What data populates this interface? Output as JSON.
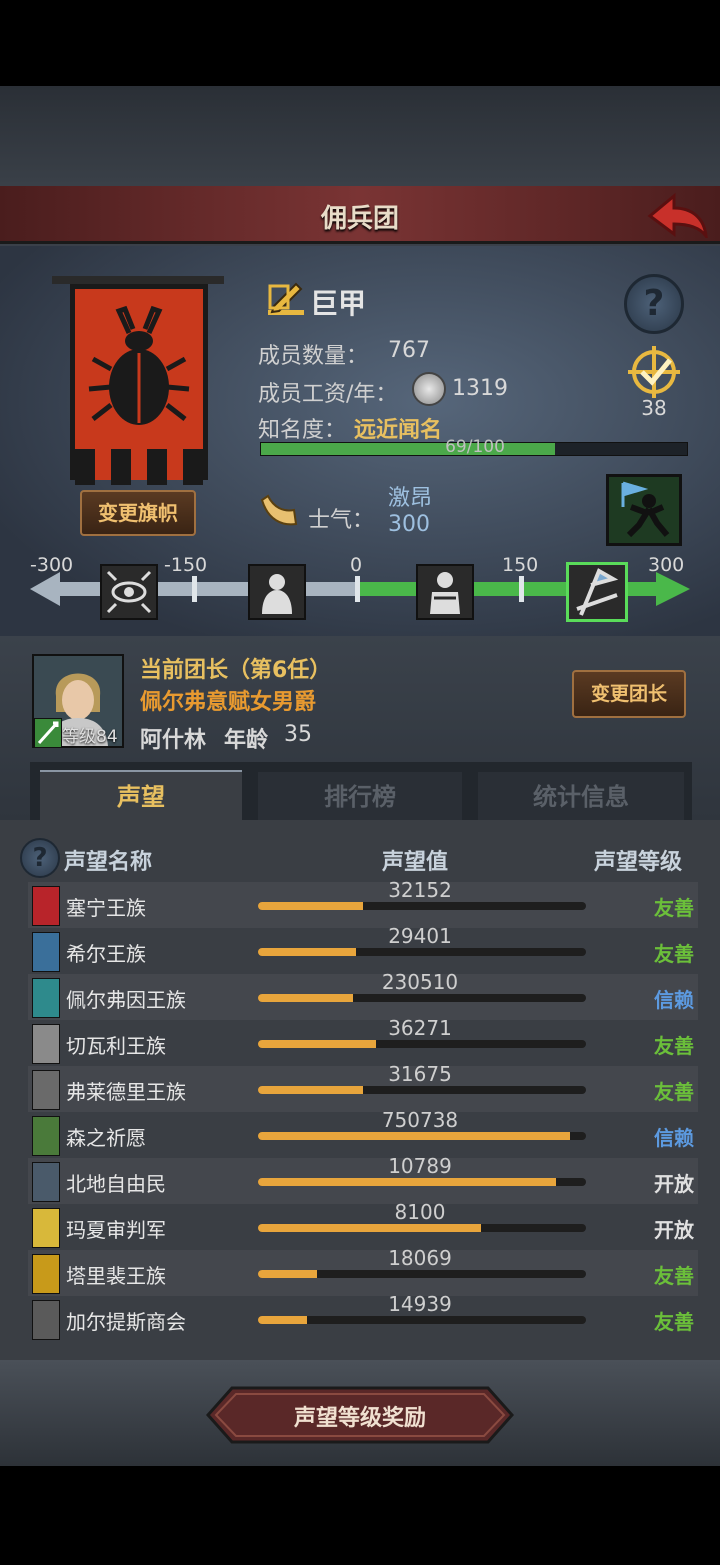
{
  "title": "佣兵团",
  "legion": {
    "name": "巨甲",
    "members_label": "成员数量：",
    "members": "767",
    "wage_label": "成员工资/年：",
    "wage": "1319",
    "fame_label": "知名度：",
    "fame": "远近闻名",
    "fame_progress": "69/100",
    "fame_fraction": 0.69,
    "rank_value": "38",
    "change_flag": "变更旗帜"
  },
  "morale": {
    "label": "士气：",
    "state": "激昂",
    "value": "300",
    "ticks": [
      "-300",
      "-150",
      "0",
      "150",
      "300"
    ],
    "level": 1.0
  },
  "leader": {
    "title": "当前团长（第6任）",
    "honor": "佩尔弗意赋女男爵",
    "name": "阿什林",
    "age_label": "年龄",
    "age": "35",
    "level": "等级84",
    "change": "变更团长"
  },
  "tabs": [
    "声望",
    "排行榜",
    "统计信息"
  ],
  "table_headers": {
    "name": "声望名称",
    "value": "声望值",
    "level": "声望等级"
  },
  "factions": [
    {
      "name": "塞宁王族",
      "value": "32152",
      "level": "友善",
      "fill": 0.32,
      "color": "#b8242a"
    },
    {
      "name": "希尔王族",
      "value": "29401",
      "level": "友善",
      "fill": 0.3,
      "color": "#3a6f9a"
    },
    {
      "name": "佩尔弗因王族",
      "value": "230510",
      "level": "信赖",
      "fill": 0.29,
      "color": "#2e8a8c"
    },
    {
      "name": "切瓦利王族",
      "value": "36271",
      "level": "友善",
      "fill": 0.36,
      "color": "#8a8a8a"
    },
    {
      "name": "弗莱德里王族",
      "value": "31675",
      "level": "友善",
      "fill": 0.32,
      "color": "#6a6a6a"
    },
    {
      "name": "森之祈愿",
      "value": "750738",
      "level": "信赖",
      "fill": 0.95,
      "color": "#4a7a3a"
    },
    {
      "name": "北地自由民",
      "value": "10789",
      "level": "开放",
      "fill": 0.91,
      "color": "#4a5a6a"
    },
    {
      "name": "玛夏审判军",
      "value": "8100",
      "level": "开放",
      "fill": 0.68,
      "color": "#d8b83a"
    },
    {
      "name": "塔里裴王族",
      "value": "18069",
      "level": "友善",
      "fill": 0.18,
      "color": "#c89a1a"
    },
    {
      "name": "加尔提斯商会",
      "value": "14939",
      "level": "友善",
      "fill": 0.15,
      "color": "#5a5a5a"
    }
  ],
  "level_colors": {
    "友善": "#6bbf3a",
    "信赖": "#5c9ae0",
    "开放": "#e0e0e0"
  },
  "reward_button": "声望等级奖励"
}
